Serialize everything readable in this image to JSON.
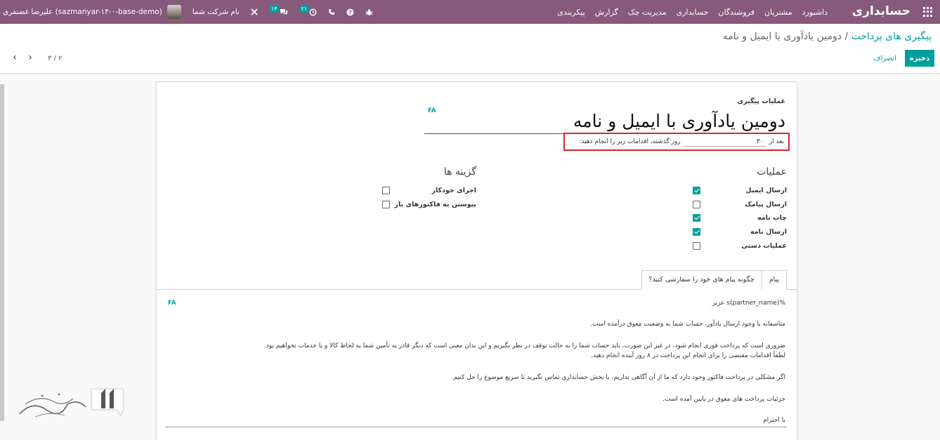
{
  "navbar": {
    "brand": "حسابداری",
    "menu": [
      "داشبورد",
      "مشتریان",
      "فروشندگان",
      "حسابداری",
      "مدیریت چک",
      "گزارش",
      "پیکربندی"
    ],
    "user_label": "علیرضا غضنفری (sazmanyar-۱۴-۰-base-demo)",
    "company_label": "نام شرکت شما",
    "activity_count": "۲۱",
    "message_count": "۱۴",
    "icons": [
      "apps-grid-icon",
      "bug-icon",
      "help-icon",
      "phone-icon",
      "clock-icon",
      "chat-icon",
      "tools-icon"
    ]
  },
  "breadcrumb": {
    "parent": "پیگیری های پرداخت",
    "separator": "/",
    "current": "دومین یادآوری با ایمیل و نامه"
  },
  "actions": {
    "save": "ذخیره",
    "discard": "انصراف"
  },
  "pager": {
    "value": "۳ / ۲"
  },
  "form": {
    "section_label": "عملیات پیگیری",
    "lang_tag": "FA",
    "title": "دومین یادآوری با ایمیل و نامه",
    "delay_prefix": "بعد از",
    "delay_value": "۳۰",
    "delay_suffix": "روز گذشته، اقدامات زیر را انجام دهید:",
    "operations_title": "عملیات",
    "operations": [
      {
        "label": "ارسال ایمیل",
        "checked": true
      },
      {
        "label": "ارسال پیامک",
        "checked": false
      },
      {
        "label": "چاپ نامه",
        "checked": true
      },
      {
        "label": "ارسال نامه",
        "checked": true
      },
      {
        "label": "عملیات دستی",
        "checked": false
      }
    ],
    "options_title": "گزینه ها",
    "options": [
      {
        "label": "اجرای خودکار",
        "checked": false
      },
      {
        "label": "پیوستن به فاکتورهای باز",
        "checked": false
      }
    ]
  },
  "tabs": [
    {
      "label": "پیام",
      "active": true
    },
    {
      "label": "چگونه پیام های خود را سفارشی کنید؟",
      "active": false
    }
  ],
  "message": {
    "lang_tag": "FA",
    "lines": [
      "%s(partner_name) عزیز",
      "متاسفانه با وجود ارسال یادآور، حساب شما به وضعیت معوق درآمده است.",
      "ضروری است که پرداخت فوری انجام شود، در غیر این صورت، باید حساب شما را به حالت توقف در نظر بگیریم و این بدان معنی است که دیگر قادر به تأمین شما به لحاظ کالا و یا خدمات نخواهیم بود.",
      "لطفاً اقدامات مقتضی را برای انجام این پرداخت در ۸ روز آینده انجام دهید.",
      "اگر مشکلی در پرداخت فاکتور وجود دارد که ما از آن آگاهی نداریم، با بخش حسابداری  تماس بگیرید تا سریع موضوع را حل کنیم.",
      "جزئیات پرداخت های معوق در پایین آمده است.",
      "با احترام"
    ]
  },
  "colors": {
    "navbar": "#875a7b",
    "accent": "#00a09d",
    "highlight": "#d9262e"
  }
}
